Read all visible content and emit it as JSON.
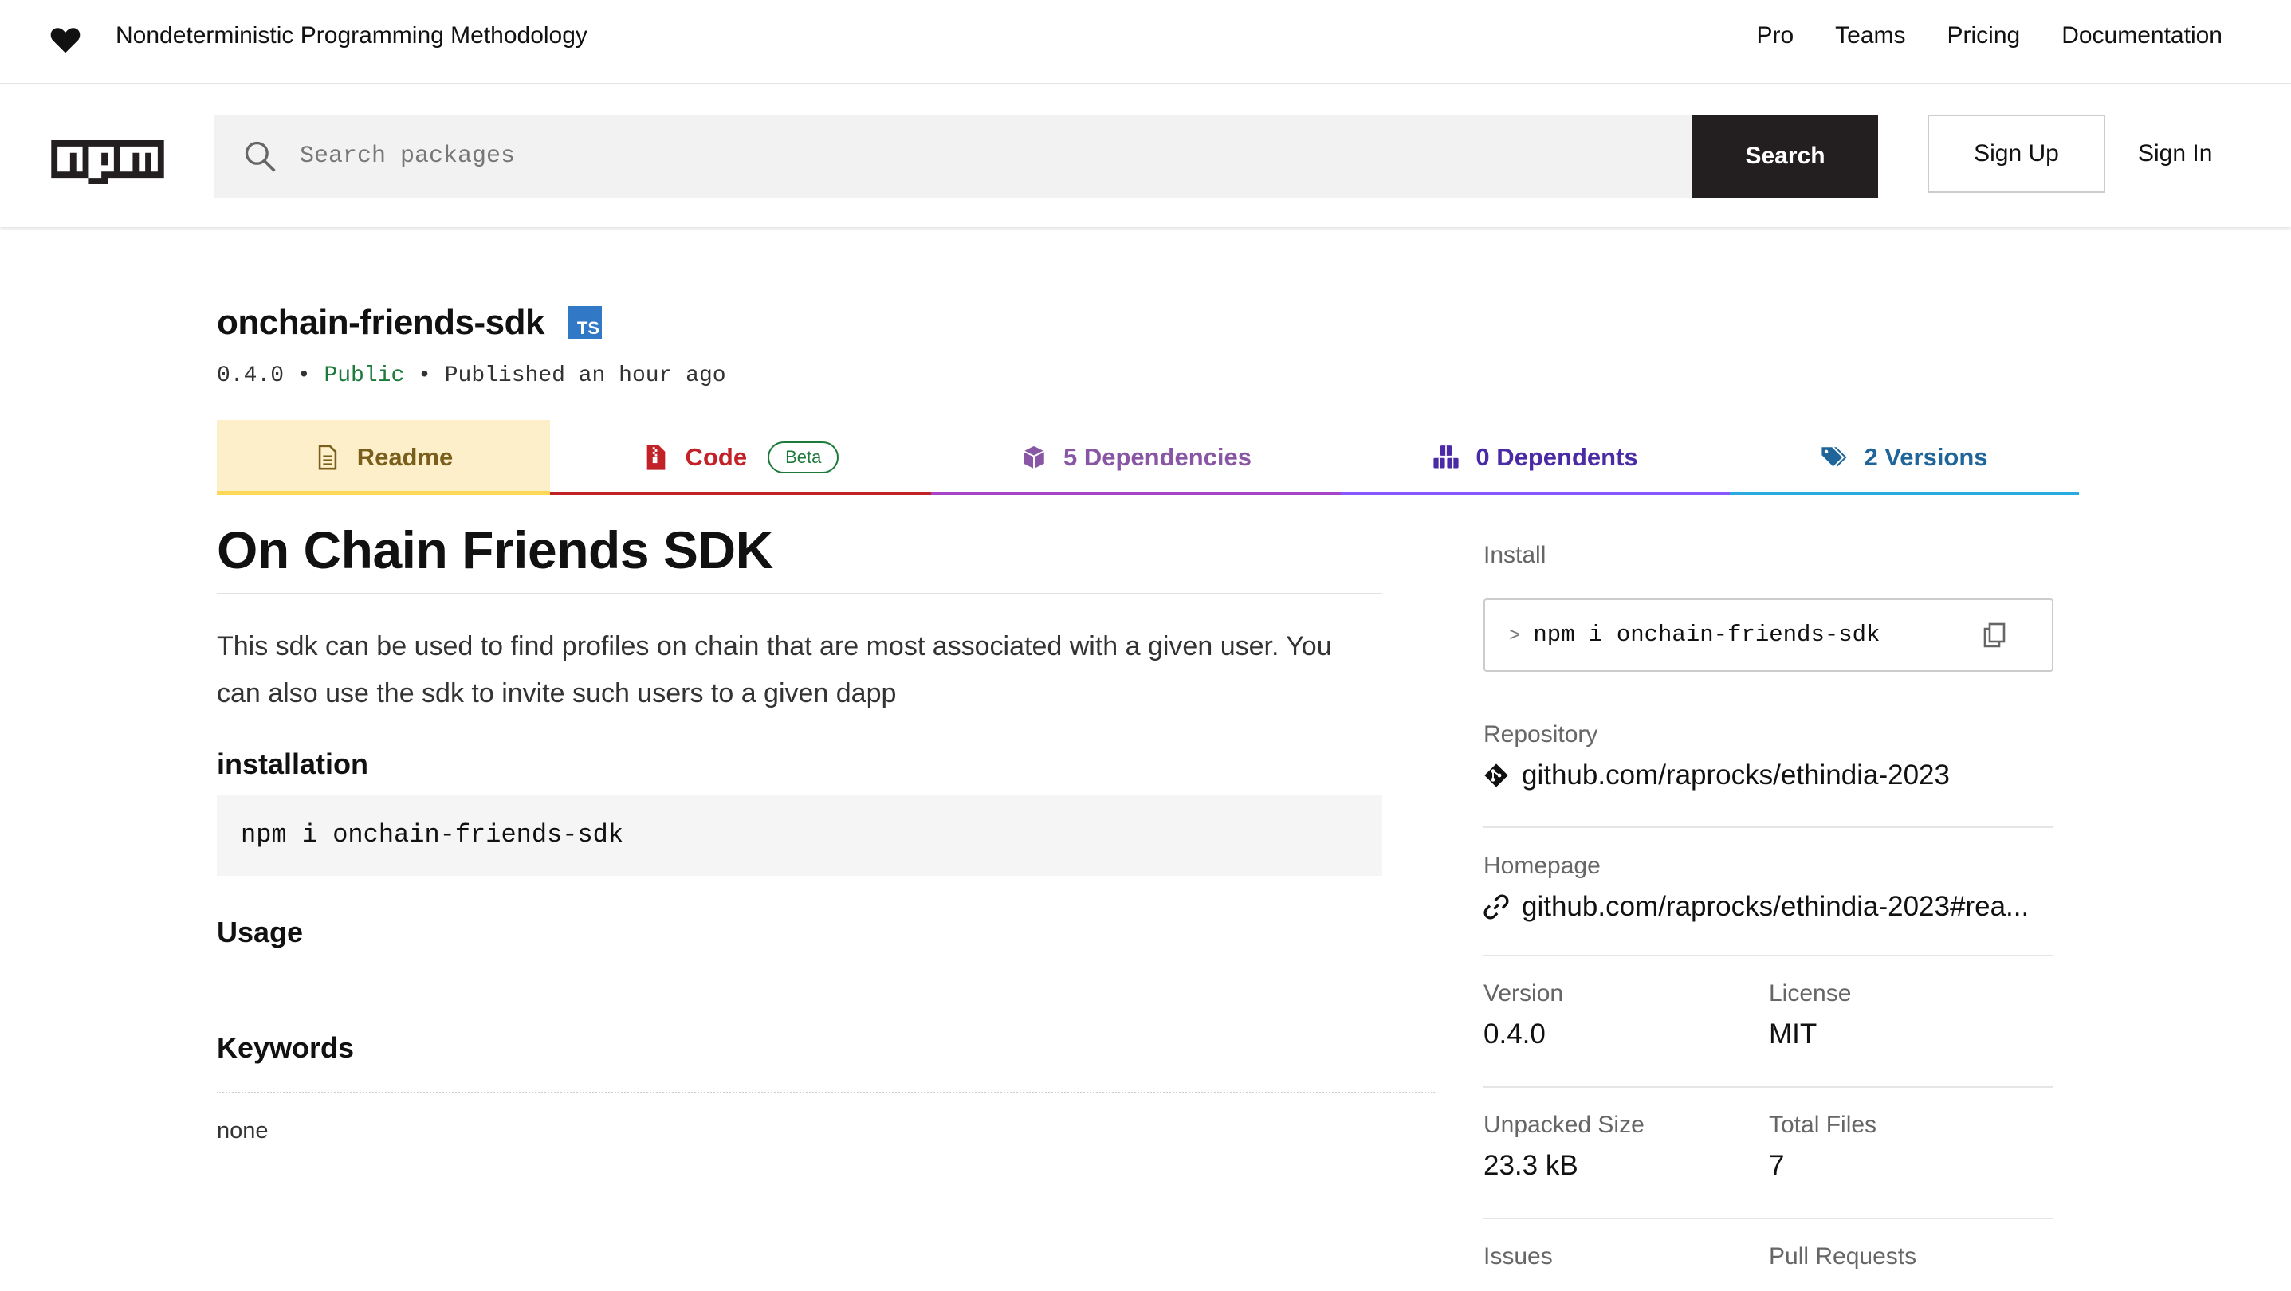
{
  "topbar": {
    "tagline": "Nondeterministic Programming Methodology",
    "nav": [
      "Pro",
      "Teams",
      "Pricing",
      "Documentation"
    ]
  },
  "header": {
    "search_placeholder": "Search packages",
    "search_button": "Search",
    "signup": "Sign Up",
    "signin": "Sign In"
  },
  "package": {
    "name": "onchain-friends-sdk",
    "ts_badge": "TS",
    "version": "0.4.0",
    "visibility": "Public",
    "published": "Published an hour ago",
    "separator": "•"
  },
  "tabs": {
    "readme": "Readme",
    "code": "Code",
    "code_badge": "Beta",
    "dependencies": "5 Dependencies",
    "dependents": "0 Dependents",
    "versions": "2 Versions"
  },
  "readme": {
    "title": "On Chain Friends SDK",
    "description": "This sdk can be used to find profiles on chain that are most associated with a given user. You can also use the sdk to invite such users to a given dapp",
    "installation_heading": "installation",
    "install_code": "npm i onchain-friends-sdk",
    "usage_heading": "Usage",
    "keywords_heading": "Keywords",
    "keywords_value": "none"
  },
  "sidebar": {
    "install_label": "Install",
    "install_command": "npm i onchain-friends-sdk",
    "repository_label": "Repository",
    "repository_value": "github.com/raprocks/ethindia-2023",
    "homepage_label": "Homepage",
    "homepage_value": "github.com/raprocks/ethindia-2023#rea...",
    "version_label": "Version",
    "version_value": "0.4.0",
    "license_label": "License",
    "license_value": "MIT",
    "unpacked_size_label": "Unpacked Size",
    "unpacked_size_value": "23.3 kB",
    "total_files_label": "Total Files",
    "total_files_value": "7",
    "issues_label": "Issues",
    "pull_requests_label": "Pull Requests"
  },
  "colors": {
    "npm_red": "#cb3837",
    "readme_tab_bg": "#fcefc9",
    "public_green": "#1d7a3b",
    "ts_blue": "#3178c6"
  }
}
